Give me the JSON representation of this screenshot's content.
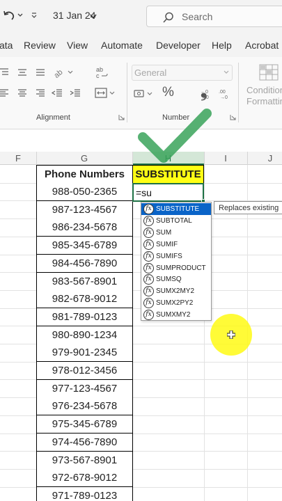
{
  "titlebar": {
    "date": "31 Jan 24",
    "search_label": "Search"
  },
  "menu": {
    "items": [
      "ata",
      "Review",
      "View",
      "Automate",
      "Developer",
      "Help",
      "Acrobat"
    ]
  },
  "ribbon": {
    "alignment_label": "Alignment",
    "number_label": "Number",
    "number_format": "General",
    "percent_symbol": "%",
    "comma_symbol": "❟",
    "conditional_line1": "Condition",
    "conditional_line2": "Formatting"
  },
  "columns": {
    "f": "F",
    "g": "G",
    "h": "H",
    "i": "I",
    "j": "J"
  },
  "sheet": {
    "phone_header": "Phone Numbers",
    "substitute_header": "SUBSTITUTE",
    "active_cell_value": "=su",
    "phones": [
      "988-050-2365",
      "987-123-4567",
      "986-234-5678",
      "985-345-6789",
      "984-456-7890",
      "983-567-8901",
      "982-678-9012",
      "981-789-0123",
      "980-890-1234",
      "979-901-2345",
      "978-012-3456",
      "977-123-4567",
      "976-234-5678",
      "975-345-6789",
      "974-456-7890",
      "973-567-8901",
      "972-678-9012",
      "971-789-0123"
    ]
  },
  "autocomplete": {
    "fx_label": "fx",
    "items": [
      "SUBSTITUTE",
      "SUBTOTAL",
      "SUM",
      "SUMIF",
      "SUMIFS",
      "SUMPRODUCT",
      "SUMSQ",
      "SUMX2MY2",
      "SUMX2PY2",
      "SUMXMY2"
    ],
    "selected": "SUBSTITUTE",
    "tooltip": "Replaces existing"
  },
  "colors": {
    "accent_green": "#1e7145",
    "header_yellow": "#ffff14",
    "selection_blue": "#0a64c8",
    "checkmark_green": "#3aa35a",
    "cursor_highlight": "#fffa14"
  }
}
